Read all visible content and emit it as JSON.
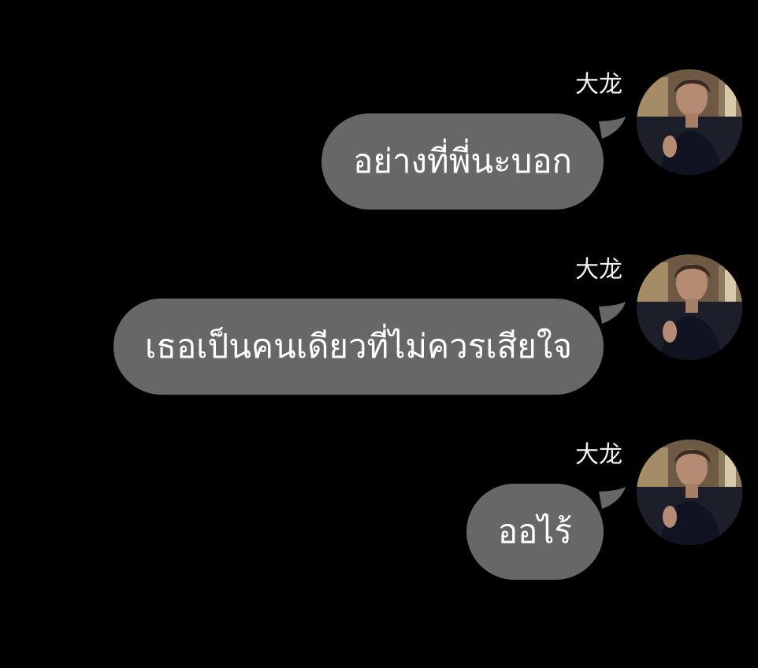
{
  "theme": {
    "background": "#000000",
    "bubble_color": "#676767",
    "text_color": "#ffffff"
  },
  "messages": [
    {
      "sender": "大龙",
      "text": "อย่างที่พี่นะบอก",
      "avatar": "profile-photo"
    },
    {
      "sender": "大龙",
      "text": "เธอเป็นคนเดียวที่ไม่ควรเสียใจ",
      "avatar": "profile-photo"
    },
    {
      "sender": "大龙",
      "text": "ออไร้",
      "avatar": "profile-photo"
    }
  ]
}
